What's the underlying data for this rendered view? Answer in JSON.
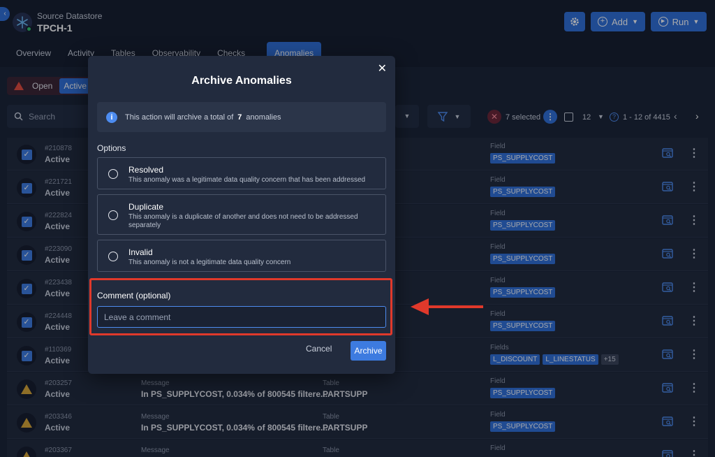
{
  "header": {
    "datastore_label": "Source Datastore",
    "datastore_name": "TPCH-1",
    "add_label": "Add",
    "run_label": "Run"
  },
  "tabs": [
    "Overview",
    "Activity",
    "Tables",
    "Observability",
    "Checks",
    "Anomalies"
  ],
  "status_filter": {
    "open": "Open",
    "active": "Active"
  },
  "search": {
    "placeholder": "Search"
  },
  "selection": {
    "selected_text": "7 selected",
    "per_page": "12",
    "range": "1 - 12 of 4415"
  },
  "rows": [
    {
      "id": "#210878",
      "status": "Active",
      "field_label": "Field",
      "chips": [
        "PS_SUPPLYCOST"
      ],
      "checked": true
    },
    {
      "id": "#221721",
      "status": "Active",
      "field_label": "Field",
      "chips": [
        "PS_SUPPLYCOST"
      ],
      "checked": true
    },
    {
      "id": "#222824",
      "status": "Active",
      "field_label": "Field",
      "chips": [
        "PS_SUPPLYCOST"
      ],
      "checked": true
    },
    {
      "id": "#223090",
      "status": "Active",
      "field_label": "Field",
      "chips": [
        "PS_SUPPLYCOST"
      ],
      "checked": true
    },
    {
      "id": "#223438",
      "status": "Active",
      "field_label": "Field",
      "chips": [
        "PS_SUPPLYCOST"
      ],
      "checked": true
    },
    {
      "id": "#224448",
      "status": "Active",
      "field_label": "Field",
      "chips": [
        "PS_SUPPLYCOST"
      ],
      "checked": true
    },
    {
      "id": "#110369",
      "status": "Active",
      "field_label": "Fields",
      "chips": [
        "L_DISCOUNT",
        "L_LINESTATUS"
      ],
      "more": "+15",
      "checked": true
    },
    {
      "id": "#203257",
      "status": "Active",
      "message_label": "Message",
      "message": "In PS_SUPPLYCOST, 0.034% of 800545 filtere...",
      "table_label": "Table",
      "table": "PARTSUPP",
      "field_label": "Field",
      "chips": [
        "PS_SUPPLYCOST"
      ],
      "checked": false
    },
    {
      "id": "#203346",
      "status": "Active",
      "message_label": "Message",
      "message": "In PS_SUPPLYCOST, 0.034% of 800545 filtere...",
      "table_label": "Table",
      "table": "PARTSUPP",
      "field_label": "Field",
      "chips": [
        "PS_SUPPLYCOST"
      ],
      "checked": false
    },
    {
      "id": "#203367",
      "status": "",
      "message_label": "Message",
      "message": "",
      "table_label": "Table",
      "table": "",
      "field_label": "Field",
      "chips": [],
      "checked": false
    }
  ],
  "modal": {
    "title": "Archive Anomalies",
    "info_text": "This action will archive a total of",
    "info_count": "7",
    "info_tail": "anomalies",
    "options_label": "Options",
    "options": [
      {
        "title": "Resolved",
        "desc": "This anomaly was a legitimate data quality concern that has been addressed"
      },
      {
        "title": "Duplicate",
        "desc": "This anomaly is a duplicate of another and does not need to be addressed separately"
      },
      {
        "title": "Invalid",
        "desc": "This anomaly is not a legitimate data quality concern"
      }
    ],
    "comment_label": "Comment (optional)",
    "comment_placeholder": "Leave a comment",
    "cancel_label": "Cancel",
    "archive_label": "Archive"
  },
  "colors": {
    "accent": "#2f6fd8",
    "background": "#1a2233",
    "highlight": "#e0392b"
  }
}
